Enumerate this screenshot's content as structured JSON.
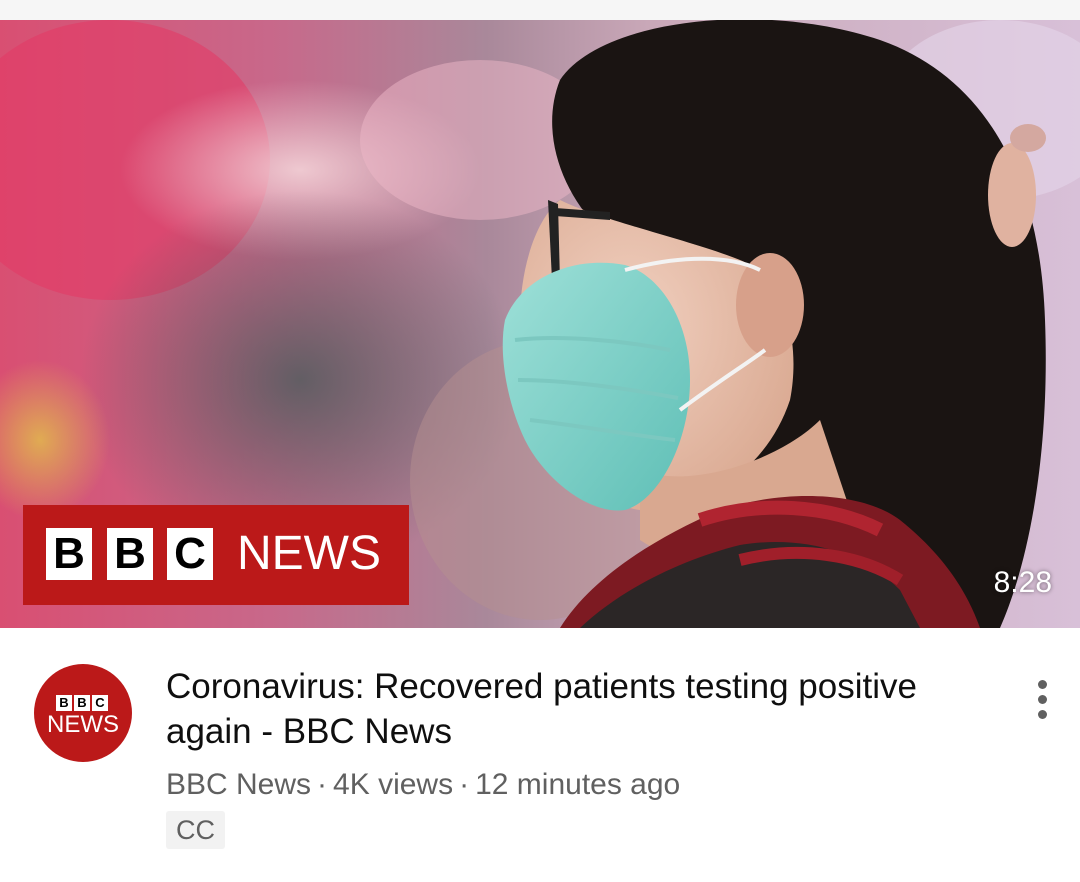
{
  "video": {
    "duration": "8:28",
    "title": "Coronavirus: Recovered patients testing positive again - BBC News",
    "channel": "BBC News",
    "views": "4K views",
    "age": "12 minutes ago",
    "badge": "CC",
    "separator": "·"
  },
  "thumbnail": {
    "logo_letters": [
      "B",
      "B",
      "C"
    ],
    "logo_word": "NEWS",
    "logo_color": "#bb1919"
  },
  "avatar": {
    "letters": [
      "B",
      "B",
      "C"
    ],
    "word": "NEWS",
    "color": "#bb1919"
  },
  "icons": {
    "more": "more-vert-icon"
  }
}
